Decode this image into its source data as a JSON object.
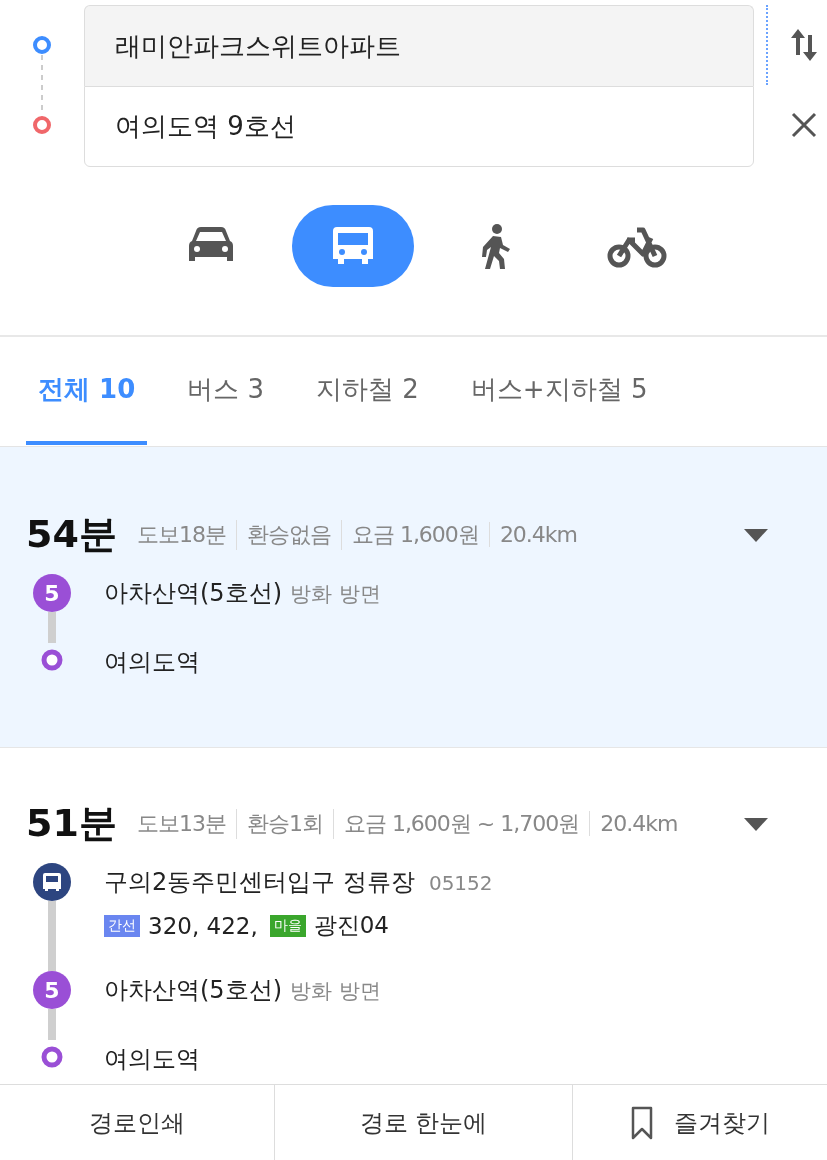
{
  "search": {
    "origin": {
      "value": "래미안파크스위트아파트"
    },
    "destination": {
      "value": "여의도역 9호선"
    }
  },
  "modes": [
    {
      "kind": "car",
      "selected": false
    },
    {
      "kind": "bus",
      "selected": true
    },
    {
      "kind": "walk",
      "selected": false
    },
    {
      "kind": "bike",
      "selected": false
    }
  ],
  "tabs": [
    {
      "label": "전체 10",
      "selected": true
    },
    {
      "label": "버스 3",
      "selected": false
    },
    {
      "label": "지하철 2",
      "selected": false
    },
    {
      "label": "버스+지하철 5",
      "selected": false
    }
  ],
  "routes": [
    {
      "selected": true,
      "time": "54분",
      "stats": [
        "도보18분",
        "환승없음",
        "요금 1,600원",
        "20.4km"
      ],
      "legs": [
        {
          "kind": "subway",
          "badge": "5",
          "color": "#9a4fd6",
          "name": "아차산역(5호선)",
          "direction": "방화 방면"
        },
        {
          "kind": "end",
          "color": "#9a4fd6",
          "name": "여의도역"
        }
      ]
    },
    {
      "selected": false,
      "time": "51분",
      "stats": [
        "도보13분",
        "환승1회",
        "요금 1,600원 ~ 1,700원",
        "20.4km"
      ],
      "legs": [
        {
          "kind": "bus",
          "color": "#2d4580",
          "name": "구의2동주민센터입구 정류장",
          "code": "05152",
          "buses": [
            {
              "tag": "간선",
              "color": "#6a86f0",
              "numbers": "320, 422,"
            },
            {
              "tag": "마을",
              "color": "#3aa62c",
              "numbers": "광진04"
            }
          ]
        },
        {
          "kind": "subway",
          "badge": "5",
          "color": "#9a4fd6",
          "name": "아차산역(5호선)",
          "direction": "방화 방면"
        },
        {
          "kind": "end",
          "color": "#9a4fd6",
          "name": "여의도역"
        }
      ]
    }
  ],
  "footer": [
    {
      "kind": "print",
      "label": "경로인쇄"
    },
    {
      "kind": "overview",
      "label": "경로 한눈에"
    },
    {
      "kind": "favorite",
      "label": "즐겨찾기"
    }
  ]
}
